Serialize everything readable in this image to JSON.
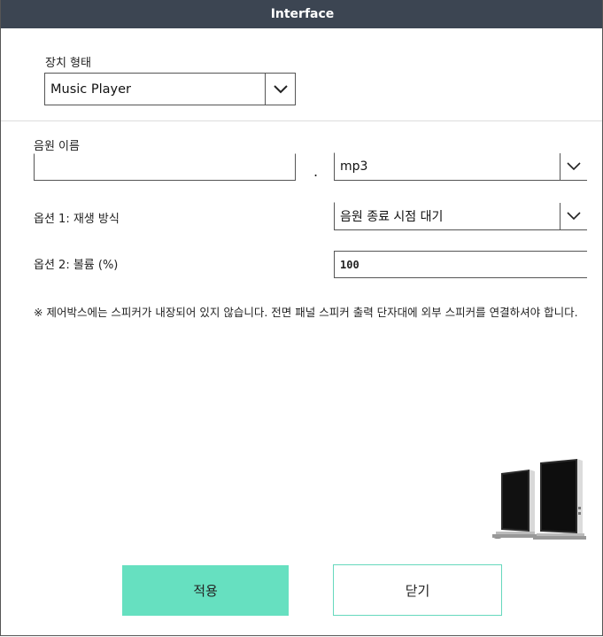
{
  "window": {
    "title": "Interface"
  },
  "device": {
    "label": "장치 형태",
    "selected": "Music Player"
  },
  "audio": {
    "name_label": "음원 이름",
    "name_value": "",
    "separator": ".",
    "extension_selected": "mp3"
  },
  "option1": {
    "label": "옵션 1: 재생 방식",
    "selected": "음원 종료 시점 대기"
  },
  "option2": {
    "label": "옵션 2: 볼륨 (%)",
    "value": "100"
  },
  "note": "※ 제어박스에는 스피커가 내장되어 있지 않습니다. 전면 패널 스피커 출력 단자대에 외부 스피커를 연결하셔야 합니다.",
  "buttons": {
    "apply": "적용",
    "close": "닫기"
  },
  "colors": {
    "titlebar": "#3c4552",
    "accent": "#66e0c0"
  },
  "icons": {
    "dropdown": "chevron-down-icon",
    "speakers": "speakers-icon"
  }
}
